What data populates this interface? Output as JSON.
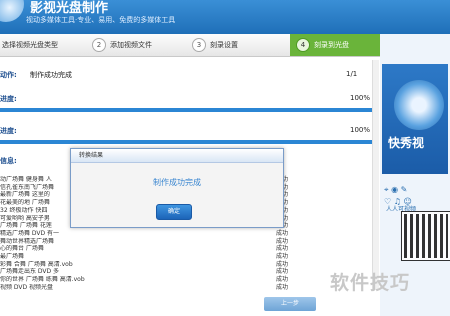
{
  "app": {
    "title": "影视光盘制作",
    "subtitle": "视动多媒体工具·专业、易用、免费的多媒体工具"
  },
  "steps": [
    {
      "num": "",
      "label": "选择视频光盘类型"
    },
    {
      "num": "2",
      "label": "添加视频文件"
    },
    {
      "num": "3",
      "label": "刻录设置"
    },
    {
      "num": "4",
      "label": "刻录到光盘"
    }
  ],
  "rows": {
    "action_label": "动作:",
    "action_value": "制作成功完成",
    "action_count": "1/1",
    "progress1_label": "进度:",
    "progress1_value": "100%",
    "progress1_fill": 1.0,
    "progress2_label": "进度:",
    "progress2_value": "100%",
    "progress2_fill": 1.0,
    "info_label": "信息:"
  },
  "info_lines": [
    "动广场舞 健身舞 人",
    "信孔雀东南飞广场舞",
    "最新广场舞 这里的",
    "花最美的地 广场舞",
    "32 终极动作 快四",
    "可爱哟哟 高安子男",
    "广场舞 广场舞 花莲",
    "精选广场舞 DVD 有一",
    "舞动世界精选广场舞",
    "心的舞台 广场舞",
    "最广场舞",
    "彩舞 合舞 广场舞 高清.vob",
    "广场舞走出东 DVD 多",
    "你的世界 广场舞 练舞 高清.vob",
    "视频 DVD 视频光盘"
  ],
  "status_lines": [
    "成功",
    "成功",
    "成功",
    "成功",
    "成功",
    "成功",
    "成功",
    "成功",
    "成功",
    "成功",
    "成功",
    "成功",
    "成功",
    "成功",
    "成功"
  ],
  "dialog": {
    "title": "转换结果",
    "message": "制作成功完成",
    "ok_label": "确定"
  },
  "ad": {
    "title": "快秀视",
    "caption": "人人可视频"
  },
  "footer": {
    "prev_label": "上一步"
  },
  "watermark": "软件技巧"
}
